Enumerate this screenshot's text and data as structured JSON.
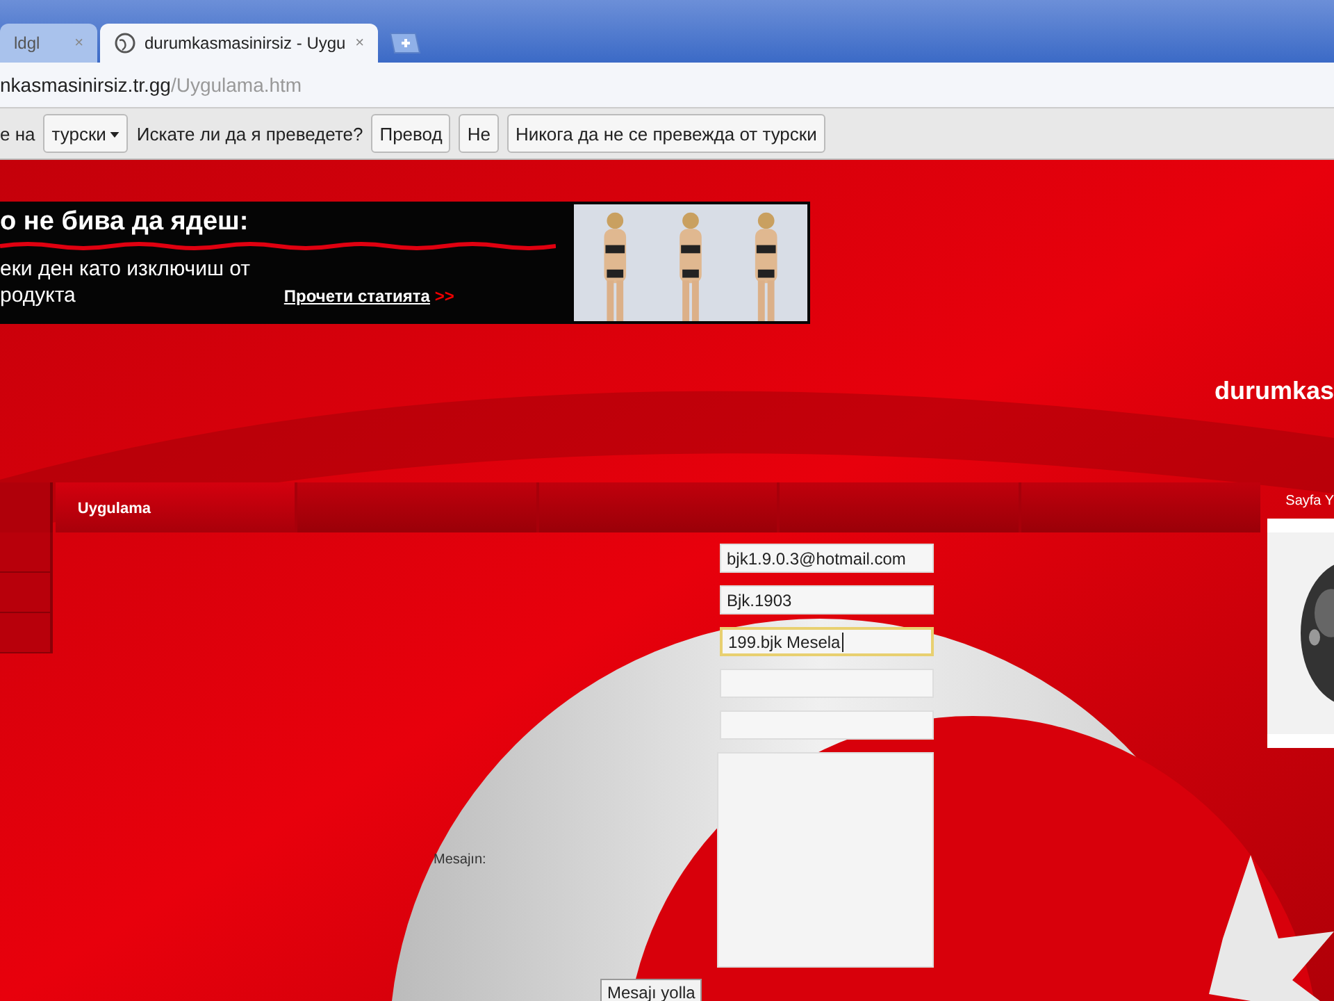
{
  "browser": {
    "tabs": [
      {
        "title": "ldgl",
        "close": "×",
        "selected": false
      },
      {
        "title": "durumkasmasinirsiz - Uygu",
        "close": "×",
        "selected": true
      }
    ],
    "address": {
      "host": "nkasmasinirsiz.tr.gg",
      "path": "/Uygulama.htm"
    }
  },
  "translate_bar": {
    "prefix": "е на",
    "language": "турски",
    "question": "Искате ли да я преведете?",
    "buttons": [
      "Превод",
      "Не",
      "Никога да не се превежда от турски"
    ]
  },
  "ad": {
    "headline": "о не бива да ядеш:",
    "line_1": "еки ден като изключиш от",
    "line_2": "родукта",
    "link": "Прочети статията",
    "link_arrows": ">>",
    "kind": "picture"
  },
  "site_title": "durumkas",
  "nav": {
    "items": [
      {
        "label": "Uygulama",
        "selected": true
      }
    ],
    "side_heading": "Sayfa Y"
  },
  "form": {
    "fields": [
      {
        "value": "bjk1.9.0.3@hotmail.com",
        "focused": false
      },
      {
        "value": "Bjk.1903",
        "focused": false
      },
      {
        "value": "199.bjk Mesela",
        "focused": true
      },
      {
        "focused": false
      },
      {
        "focused": false
      }
    ],
    "message_label": "Mesajın:",
    "submit": "Mesajı yolla"
  }
}
